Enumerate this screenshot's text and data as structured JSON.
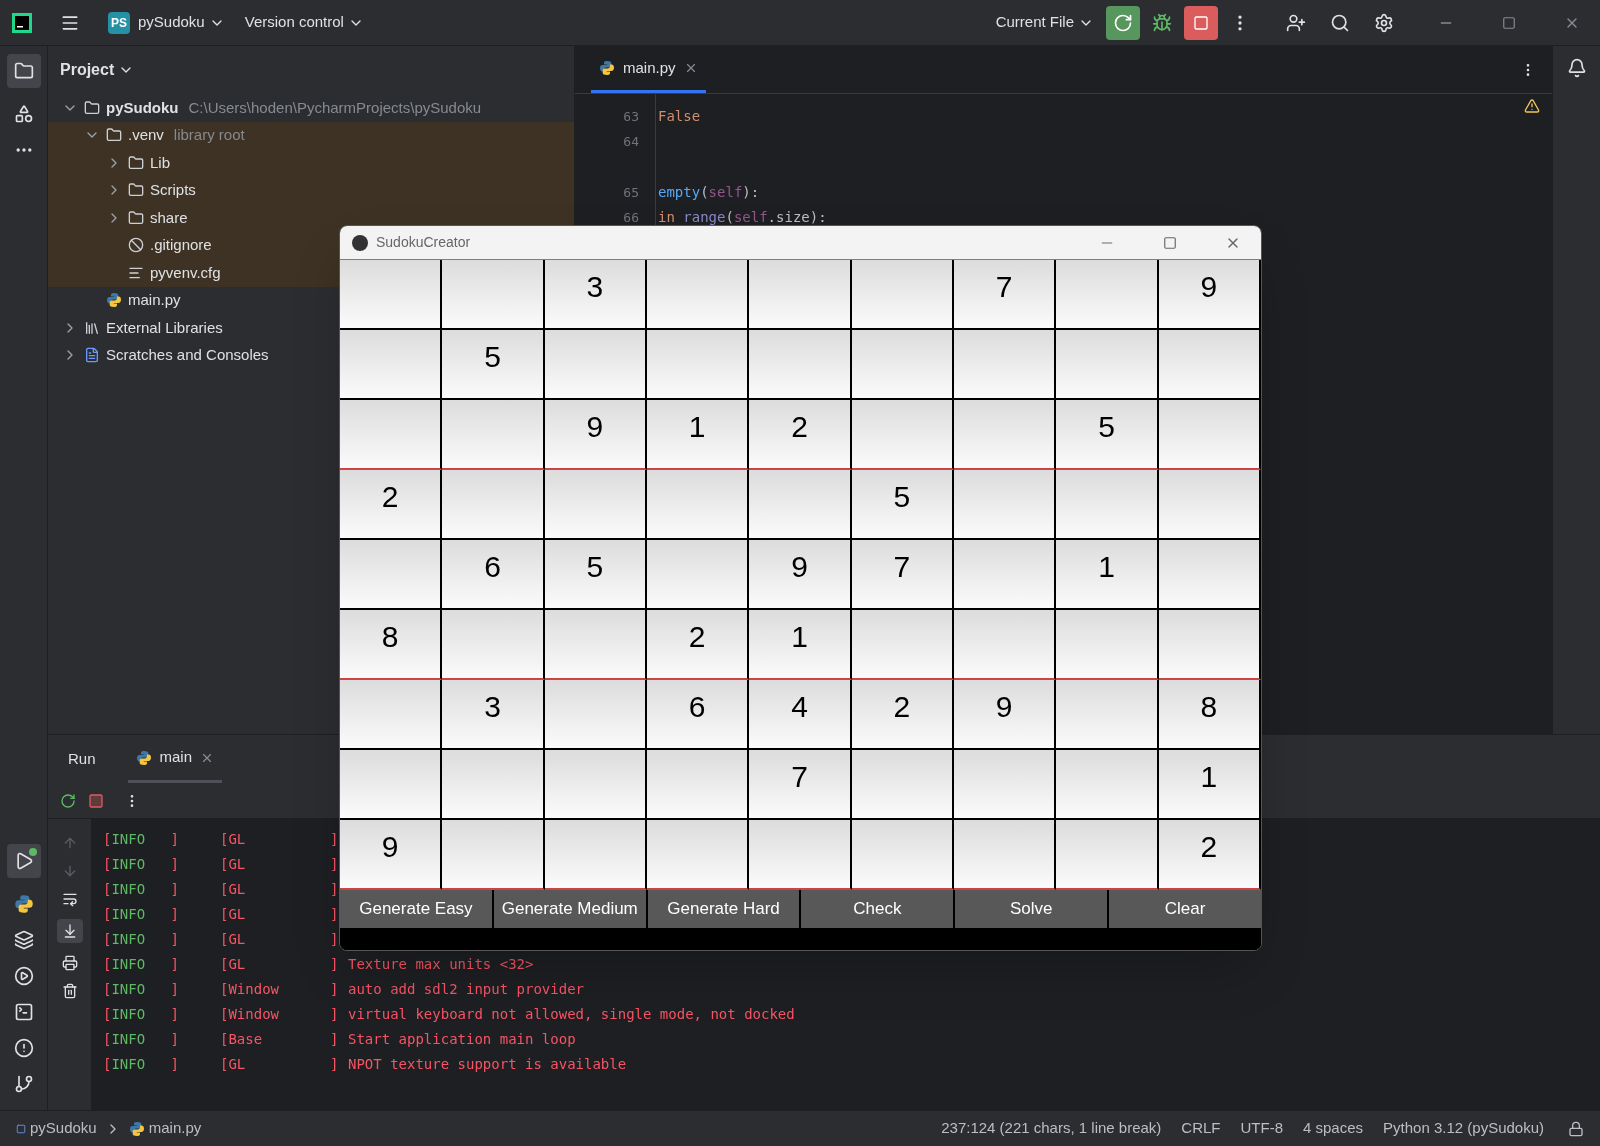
{
  "title_bar": {
    "project_badge": "PS",
    "project": "pySudoku",
    "vcs": "Version control",
    "run_config": "Current File"
  },
  "project_panel": {
    "title": "Project",
    "tree": [
      {
        "label": "pySudoku",
        "hint": "C:\\Users\\hoden\\PycharmProjects\\pySudoku",
        "kind": "folder",
        "bold": true,
        "expanded": true,
        "children": [
          {
            "label": ".venv",
            "hint": "library root",
            "kind": "folder",
            "expanded": true,
            "library": true,
            "children": [
              {
                "label": "Lib",
                "kind": "folder",
                "expanded": false
              },
              {
                "label": "Scripts",
                "kind": "folder",
                "expanded": false
              },
              {
                "label": "share",
                "kind": "folder",
                "expanded": false
              },
              {
                "label": ".gitignore",
                "kind": "ignore"
              },
              {
                "label": "pyvenv.cfg",
                "kind": "text"
              }
            ]
          },
          {
            "label": "main.py",
            "kind": "python"
          }
        ]
      },
      {
        "label": "External Libraries",
        "kind": "library",
        "expanded": false
      },
      {
        "label": "Scratches and Consoles",
        "kind": "scratches",
        "expanded": false
      }
    ]
  },
  "editor": {
    "tab": "main.py",
    "lines": [
      {
        "number": "63",
        "tokens": [
          {
            "text": "False",
            "kind": "keyword"
          }
        ]
      },
      {
        "number": "64"
      },
      {
        "kind": "gap"
      },
      {
        "number": "65",
        "tokens": [
          {
            "text": "empty",
            "kind": "function"
          },
          {
            "text": "(",
            "kind": "plain"
          },
          {
            "text": "self",
            "kind": "self"
          },
          {
            "text": "):",
            "kind": "plain"
          }
        ]
      },
      {
        "number": "66",
        "tokens": [
          {
            "text": "in ",
            "kind": "keyword"
          },
          {
            "text": "range",
            "kind": "builtin"
          },
          {
            "text": "(",
            "kind": "plain"
          },
          {
            "text": "self",
            "kind": "self"
          },
          {
            "text": ".size):",
            "kind": "plain"
          }
        ]
      }
    ]
  },
  "run_panel": {
    "tabs": [
      {
        "label": "Run",
        "selected": false,
        "closable": false
      },
      {
        "label": "main",
        "selected": true,
        "closable": true
      }
    ],
    "console": [
      {
        "bracket": "[",
        "level": "INFO",
        "level_end": "]",
        "source": "[GL",
        "source_end": "]"
      },
      {
        "bracket": "[",
        "level": "INFO",
        "level_end": "]",
        "source": "[GL",
        "source_end": "]"
      },
      {
        "bracket": "[",
        "level": "INFO",
        "level_end": "]",
        "source": "[GL",
        "source_end": "]"
      },
      {
        "bracket": "[",
        "level": "INFO",
        "level_end": "]",
        "source": "[GL",
        "source_end": "]"
      },
      {
        "bracket": "[",
        "level": "INFO",
        "level_end": "]",
        "source": "[GL",
        "source_end": "]"
      },
      {
        "bracket": "[",
        "level": "INFO",
        "level_end": "]",
        "source": "[GL",
        "source_end": "]",
        "message": "Texture max units <32>"
      },
      {
        "bracket": "[",
        "level": "INFO",
        "level_end": "]",
        "source": "[Window",
        "source_end": "]",
        "message": "auto add sdl2 input provider"
      },
      {
        "bracket": "[",
        "level": "INFO",
        "level_end": "]",
        "source": "[Window",
        "source_end": "]",
        "message": "virtual keyboard not allowed, single mode, not docked"
      },
      {
        "bracket": "[",
        "level": "INFO",
        "level_end": "]",
        "source": "[Base",
        "source_end": "]",
        "message": "Start application main loop"
      },
      {
        "bracket": "[",
        "level": "INFO",
        "level_end": "]",
        "source": "[GL",
        "source_end": "]",
        "message": "NPOT texture support is available"
      }
    ]
  },
  "sudoku_window": {
    "title": "SudokuCreator",
    "grid": [
      [
        {
          "kind": "empty"
        },
        {
          "kind": "empty"
        },
        {
          "kind": "digit",
          "value": "3"
        },
        {
          "kind": "empty"
        },
        {
          "kind": "empty"
        },
        {
          "kind": "empty"
        },
        {
          "kind": "digit",
          "value": "7"
        },
        {
          "kind": "empty"
        },
        {
          "kind": "digit",
          "value": "9"
        }
      ],
      [
        {
          "kind": "empty"
        },
        {
          "kind": "digit",
          "value": "5"
        },
        {
          "kind": "empty"
        },
        {
          "kind": "empty"
        },
        {
          "kind": "empty"
        },
        {
          "kind": "empty"
        },
        {
          "kind": "empty"
        },
        {
          "kind": "empty"
        },
        {
          "kind": "empty"
        }
      ],
      [
        {
          "kind": "empty"
        },
        {
          "kind": "empty"
        },
        {
          "kind": "digit",
          "value": "9"
        },
        {
          "kind": "digit",
          "value": "1"
        },
        {
          "kind": "digit",
          "value": "2"
        },
        {
          "kind": "empty"
        },
        {
          "kind": "empty"
        },
        {
          "kind": "digit",
          "value": "5"
        },
        {
          "kind": "empty"
        }
      ],
      [
        {
          "kind": "digit",
          "value": "2"
        },
        {
          "kind": "empty"
        },
        {
          "kind": "empty"
        },
        {
          "kind": "empty"
        },
        {
          "kind": "empty"
        },
        {
          "kind": "digit",
          "value": "5"
        },
        {
          "kind": "empty"
        },
        {
          "kind": "empty"
        },
        {
          "kind": "empty"
        }
      ],
      [
        {
          "kind": "empty"
        },
        {
          "kind": "digit",
          "value": "6"
        },
        {
          "kind": "digit",
          "value": "5"
        },
        {
          "kind": "empty"
        },
        {
          "kind": "digit",
          "value": "9"
        },
        {
          "kind": "digit",
          "value": "7"
        },
        {
          "kind": "empty"
        },
        {
          "kind": "digit",
          "value": "1"
        },
        {
          "kind": "empty"
        }
      ],
      [
        {
          "kind": "digit",
          "value": "8"
        },
        {
          "kind": "empty"
        },
        {
          "kind": "empty"
        },
        {
          "kind": "digit",
          "value": "2"
        },
        {
          "kind": "digit",
          "value": "1"
        },
        {
          "kind": "empty"
        },
        {
          "kind": "empty"
        },
        {
          "kind": "empty"
        },
        {
          "kind": "empty"
        }
      ],
      [
        {
          "kind": "empty"
        },
        {
          "kind": "digit",
          "value": "3"
        },
        {
          "kind": "empty"
        },
        {
          "kind": "digit",
          "value": "6"
        },
        {
          "kind": "digit",
          "value": "4"
        },
        {
          "kind": "digit",
          "value": "2"
        },
        {
          "kind": "digit",
          "value": "9"
        },
        {
          "kind": "empty"
        },
        {
          "kind": "digit",
          "value": "8"
        }
      ],
      [
        {
          "kind": "empty"
        },
        {
          "kind": "empty"
        },
        {
          "kind": "empty"
        },
        {
          "kind": "empty"
        },
        {
          "kind": "digit",
          "value": "7"
        },
        {
          "kind": "empty"
        },
        {
          "kind": "empty"
        },
        {
          "kind": "empty"
        },
        {
          "kind": "digit",
          "value": "1"
        }
      ],
      [
        {
          "kind": "digit",
          "value": "9"
        },
        {
          "kind": "empty"
        },
        {
          "kind": "empty"
        },
        {
          "kind": "empty"
        },
        {
          "kind": "empty"
        },
        {
          "kind": "empty"
        },
        {
          "kind": "empty"
        },
        {
          "kind": "empty"
        },
        {
          "kind": "digit",
          "value": "2"
        }
      ]
    ],
    "buttons": [
      "Generate Easy",
      "Generate Medium",
      "Generate Hard",
      "Check",
      "Solve",
      "Clear"
    ]
  },
  "status_bar": {
    "breadcrumbs": [
      "pySudoku",
      "main.py"
    ],
    "items": [
      "237:124 (221 chars, 1 line break)",
      "CRLF",
      "UTF-8",
      "4 spaces",
      "Python 3.12 (pySudoku)"
    ]
  }
}
